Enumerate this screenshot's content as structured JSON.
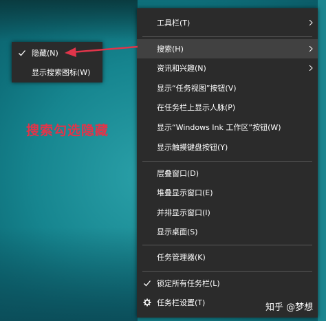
{
  "main_menu": {
    "items": [
      {
        "label": "工具栏(T)",
        "has_submenu": true
      },
      {
        "label": "搜索(H)",
        "has_submenu": true,
        "highlighted": true
      },
      {
        "label": "资讯和兴趣(N)",
        "has_submenu": true
      },
      {
        "label": "显示“任务视图”按钮(V)"
      },
      {
        "label": "在任务栏上显示人脉(P)"
      },
      {
        "label": "显示“Windows Ink 工作区”按钮(W)"
      },
      {
        "label": "显示触摸键盘按钮(Y)"
      },
      {
        "label": "层叠窗口(D)"
      },
      {
        "label": "堆叠显示窗口(E)"
      },
      {
        "label": "并排显示窗口(I)"
      },
      {
        "label": "显示桌面(S)"
      },
      {
        "label": "任务管理器(K)"
      },
      {
        "label": "锁定所有任务栏(L)",
        "checked": true,
        "icon": "check-icon"
      },
      {
        "label": "任务栏设置(T)",
        "icon": "gear-icon"
      }
    ]
  },
  "sub_menu": {
    "items": [
      {
        "label": "隐藏(N)",
        "checked": true
      },
      {
        "label": "显示搜索图标(W)"
      }
    ]
  },
  "annotation": {
    "text": "搜索勾选隐藏",
    "color": "#e0354a"
  },
  "watermark": {
    "text": "知乎 @梦想"
  },
  "colors": {
    "menu_bg": "#2b2b2b",
    "hover_bg": "#414141",
    "arrow": "#e0354a"
  }
}
